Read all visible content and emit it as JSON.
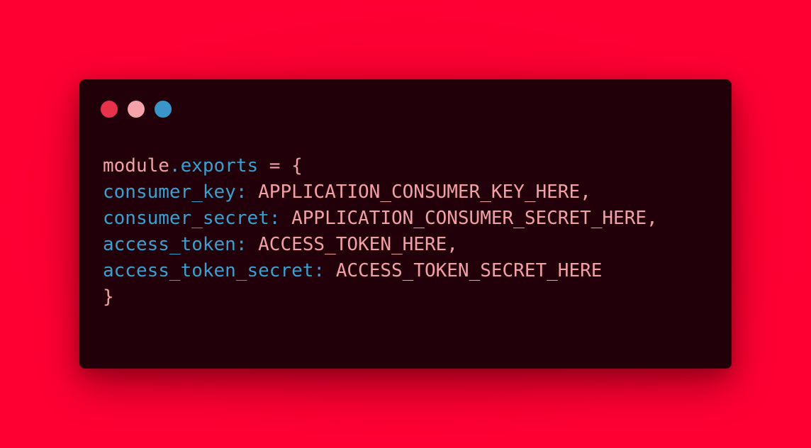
{
  "window_controls": [
    {
      "name": "close",
      "color": "#e6324b"
    },
    {
      "name": "minimize",
      "color": "#f5a3aa"
    },
    {
      "name": "maximize",
      "color": "#3a95c8"
    }
  ],
  "colors": {
    "background": "#ff0033",
    "window": "#22000a",
    "plain_text": "#f2a0a6",
    "key_text": "#3aa0d0"
  },
  "code": {
    "line1": {
      "module": "module",
      "exports": ".exports",
      "rest": " = {"
    },
    "entries": [
      {
        "key": "consumer_key:",
        "value": " APPLICATION_CONSUMER_KEY_HERE,"
      },
      {
        "key": "consumer_secret:",
        "value": " APPLICATION_CONSUMER_SECRET_HERE,"
      },
      {
        "key": "access_token:",
        "value": " ACCESS_TOKEN_HERE,"
      },
      {
        "key": "access_token_secret:",
        "value": " ACCESS_TOKEN_SECRET_HERE"
      }
    ],
    "closing": "}"
  }
}
